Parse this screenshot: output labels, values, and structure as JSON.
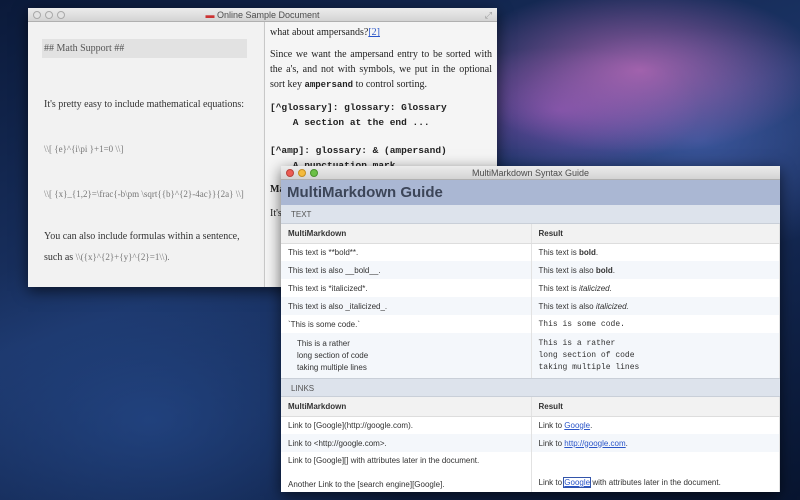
{
  "editor_window": {
    "title": "Online Sample Document",
    "source": {
      "heading": "## Math Support ##",
      "intro": "It's pretty easy to include mathematical equations:",
      "eq1": "\\\\[ {e}^{i\\pi }+1=0 \\\\]",
      "eq2": "\\\\[ {x}_{1,2}=\\frac{-b\\pm \\sqrt{{b}^{2}-4ac}}{2a} \\\\]",
      "inline_a": "You can also include formulas within a sentence,",
      "inline_b": "such as",
      "inline_math": "\\\\({x}^{2}+{y}^{2}=1\\\\)."
    },
    "preview": {
      "line1": "what about ampersands?",
      "footnote": "[2]",
      "para_a": "Since we want the ampersand entry to be sorted with the a's, and not with symbols, we put in the optional sort key",
      "para_key": "ampersand",
      "para_b": "to control sorting.",
      "code1": "[^glossary]: glossary: Glossary",
      "code2": "    A section at the end ...",
      "code3": "[^amp]: glossary: & (ampersand)",
      "code4": "    A punctuation mark ...",
      "cut1": "Ma",
      "cut2": "It's"
    }
  },
  "guide_window": {
    "title": "MultiMarkdown Syntax Guide",
    "heading": "MultiMarkdown Guide",
    "col_source": "MultiMarkdown",
    "col_result": "Result",
    "text_section": "TEXT",
    "text_rows": [
      {
        "src": "This text is **bold**.",
        "pre": "This text is ",
        "em": "bold",
        "post": "."
      },
      {
        "src": "This text is also __bold__.",
        "pre": "This text is also ",
        "em": "bold",
        "post": "."
      },
      {
        "src": "This text is *italicized*.",
        "pre": "This text is ",
        "em": "italicized.",
        "post": ""
      },
      {
        "src": "This text is also _italicized_.",
        "pre": "This text is also ",
        "em": "italicized.",
        "post": ""
      }
    ],
    "code_row": {
      "src": "`This is some code.`",
      "res": "This is some code."
    },
    "block_row": {
      "src": "This is a rather\nlong section of code\ntaking multiple lines",
      "res": "This is a rather\nlong section of code\ntaking multiple lines"
    },
    "links_section": "LINKS",
    "link_rows": [
      {
        "src": "Link to [Google](http://google.com).",
        "pre": "Link to ",
        "link": "Google",
        "post": "."
      },
      {
        "src": "Link to <http://google.com>.",
        "pre": "Link to ",
        "link": "http://google.com",
        "post": "."
      }
    ],
    "ref_row": {
      "src1": "Link to [Google][] with attributes later in the document.",
      "src2": "Another Link to the [search engine][Google].",
      "pre": "Link to ",
      "link": "Google",
      "post": " with attributes later in the document."
    }
  }
}
